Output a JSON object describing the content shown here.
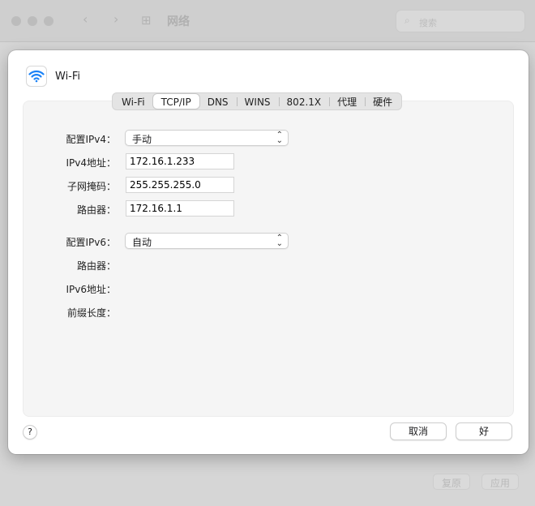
{
  "background": {
    "title": "网络",
    "nav_back": "‹",
    "nav_forward": "›",
    "search_placeholder": "搜索",
    "revert_button": "复原",
    "apply_button": "应用"
  },
  "sheet": {
    "title": "Wi-Fi",
    "tabs": [
      "Wi-Fi",
      "TCP/IP",
      "DNS",
      "WINS",
      "802.1X",
      "代理",
      "硬件"
    ],
    "active_tab": "TCP/IP",
    "ipv4": {
      "config_label": "配置IPv4：",
      "config_value": "手动",
      "address_label": "IPv4地址：",
      "address_value": "172.16.1.233",
      "subnet_label": "子网掩码：",
      "subnet_value": "255.255.255.0",
      "router_label": "路由器：",
      "router_value": "172.16.1.1"
    },
    "ipv6": {
      "config_label": "配置IPv6：",
      "config_value": "自动",
      "router_label": "路由器：",
      "address_label": "IPv6地址：",
      "prefix_label": "前缀长度："
    },
    "help_label": "?",
    "cancel_label": "取消",
    "ok_label": "好"
  },
  "colors": {
    "accent": "#1a82f7",
    "panel": "#f5f5f5"
  }
}
